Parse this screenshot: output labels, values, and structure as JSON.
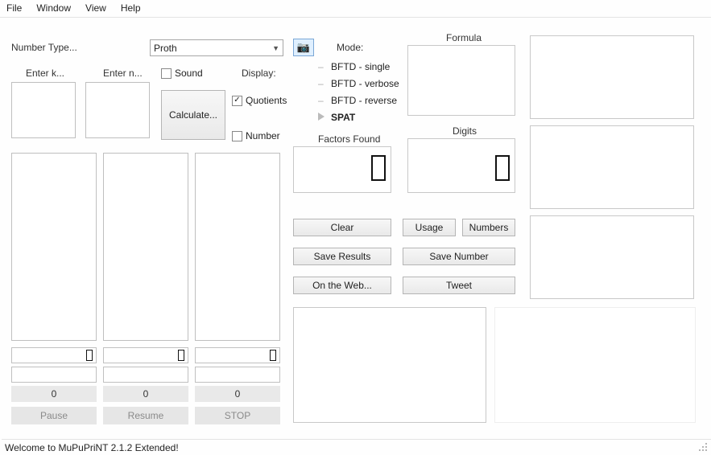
{
  "menu": {
    "file": "File",
    "window": "Window",
    "view": "View",
    "help": "Help"
  },
  "numberTypeLabel": "Number Type...",
  "numberTypeValue": "Proth",
  "enterK": "Enter k...",
  "enterN": "Enter n...",
  "soundLabel": "Sound",
  "displayLabel": "Display:",
  "quotientsLabel": "Quotients",
  "numberLabel": "Number",
  "calculateLabel": "Calculate...",
  "modeLabel": "Mode:",
  "modes": {
    "a": "BFTD - single",
    "b": "BFTD - verbose",
    "c": "BFTD - reverse",
    "d": "SPAT"
  },
  "factorsFoundLabel": "Factors Found",
  "formulaLabel": "Formula",
  "digitsLabel": "Digits",
  "btns": {
    "clear": "Clear",
    "usage": "Usage",
    "numbers": "Numbers",
    "saveResults": "Save Results",
    "saveNumber": "Save Number",
    "onWeb": "On the Web...",
    "tweet": "Tweet"
  },
  "zero": "0",
  "pause": "Pause",
  "resume": "Resume",
  "stop": "STOP",
  "status": "Welcome to MuPuPriNT 2.1.2 Extended!"
}
